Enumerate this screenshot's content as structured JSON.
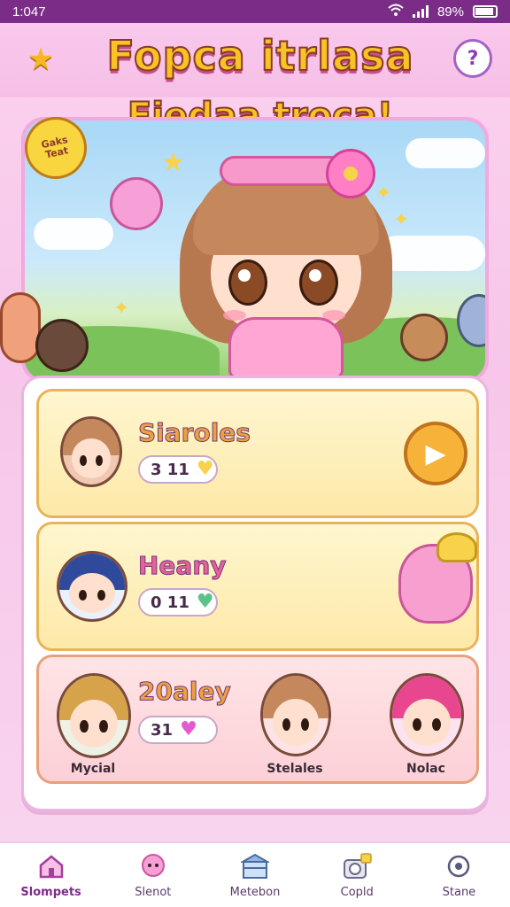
{
  "status_bar": {
    "time": "1:047",
    "battery": "89%"
  },
  "header": {
    "title_line1": "Fopca itrlasa",
    "title_line2": "Fiedaa troca!",
    "menu_icon": "star-icon",
    "help_icon": "question-icon"
  },
  "hero": {
    "badge_line1": "Gaks",
    "badge_line2": "Teat"
  },
  "cards": [
    {
      "title": "Siaroles",
      "title_color": "#f0a040",
      "stat": "3 11",
      "heart_color": "#f7d24a",
      "action": "play-icon"
    },
    {
      "title": "Heany",
      "title_color": "#e8609c",
      "stat": "0 11",
      "heart_color": "#5ac28a"
    },
    {
      "title": "20aley",
      "title_color": "#f0a040",
      "stat": "31",
      "heart_color": "#e45ad0",
      "characters": [
        {
          "label": "Mycial"
        },
        {
          "label": "Stelales"
        },
        {
          "label": "Nolac"
        }
      ]
    }
  ],
  "nav": {
    "items": [
      {
        "label": "Slompets",
        "icon": "home-icon"
      },
      {
        "label": "Slenot",
        "icon": "character-icon"
      },
      {
        "label": "Metebon",
        "icon": "shop-icon"
      },
      {
        "label": "Copld",
        "icon": "camera-icon"
      },
      {
        "label": "Stane",
        "icon": "settings-icon"
      }
    ]
  }
}
